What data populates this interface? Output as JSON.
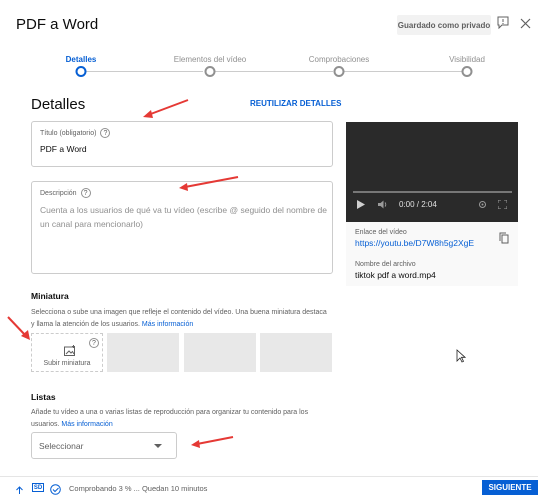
{
  "header": {
    "title": "PDF a Word",
    "saved_badge": "Guardado como privado",
    "feedback_icon": "feedback-icon",
    "close_icon": "close-icon"
  },
  "steps": [
    {
      "label": "Detalles",
      "active": true
    },
    {
      "label": "Elementos del vídeo",
      "active": false
    },
    {
      "label": "Comprobaciones",
      "active": false
    },
    {
      "label": "Visibilidad",
      "active": false
    }
  ],
  "details": {
    "heading": "Detalles",
    "reuse_label": "REUTILIZAR DETALLES",
    "title_field": {
      "label": "Título (obligatorio)",
      "value": "PDF a Word"
    },
    "description_field": {
      "label": "Descripción",
      "placeholder": "Cuenta a los usuarios de qué va tu vídeo (escribe @ seguido del nombre de un canal para mencionarlo)"
    }
  },
  "video": {
    "time": "0:00 / 2:04",
    "link_label": "Enlace del vídeo",
    "link": "https://youtu.be/D7W8h5g2XgE",
    "filename_label": "Nombre del archivo",
    "filename": "tiktok pdf a word.mp4"
  },
  "thumbnail": {
    "heading": "Miniatura",
    "description": "Selecciona o sube una imagen que refleje el contenido del vídeo. Una buena miniatura destaca y llama la atención de los usuarios.",
    "more": "Más información",
    "upload_label": "Subir miniatura"
  },
  "lists": {
    "heading": "Listas",
    "description": "Añade tu vídeo a una o varias listas de reproducción para organizar tu contenido para los usuarios.",
    "more": "Más información",
    "select_value": "Seleccionar"
  },
  "footer": {
    "status": "Comprobando 3 % ... Quedan 10 minutos",
    "sd_badge": "SD",
    "next_label": "SIGUIENTE"
  },
  "colors": {
    "accent": "#065fd4",
    "annotation_arrow": "#e53935"
  }
}
